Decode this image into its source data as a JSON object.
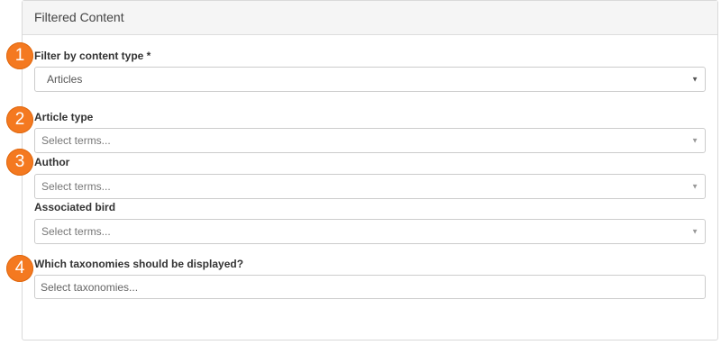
{
  "panel": {
    "title": "Filtered Content"
  },
  "badges": [
    "1",
    "2",
    "3",
    "4"
  ],
  "fields": {
    "content_type": {
      "label": "Filter by content type *",
      "value": "Articles"
    },
    "article_type": {
      "label": "Article type",
      "placeholder": "Select terms..."
    },
    "author": {
      "label": "Author",
      "placeholder": "Select terms..."
    },
    "associated_bird": {
      "label": "Associated bird",
      "placeholder": "Select terms..."
    },
    "taxonomies": {
      "label": "Which taxonomies should be displayed?",
      "placeholder": "Select taxonomies..."
    }
  },
  "icons": {
    "dropdown": "chevron-down-icon",
    "caret_glyph": "▼"
  },
  "colors": {
    "badge": "#f47920",
    "header_bg": "#f5f5f5",
    "border": "#cccccc"
  }
}
